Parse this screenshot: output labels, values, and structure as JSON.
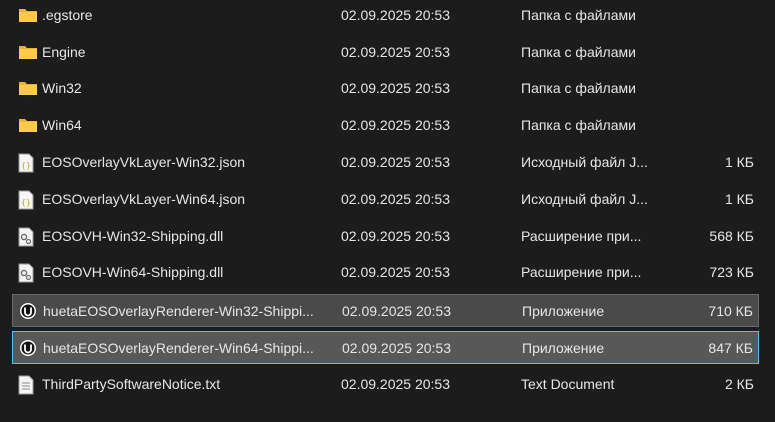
{
  "files": [
    {
      "name": ".egstore",
      "date": "02.09.2025 20:53",
      "type": "Папка с файлами",
      "size": "",
      "icon": "folder-icon"
    },
    {
      "name": "Engine",
      "date": "02.09.2025 20:53",
      "type": "Папка с файлами",
      "size": "",
      "icon": "folder-icon"
    },
    {
      "name": "Win32",
      "date": "02.09.2025 20:53",
      "type": "Папка с файлами",
      "size": "",
      "icon": "folder-icon"
    },
    {
      "name": "Win64",
      "date": "02.09.2025 20:53",
      "type": "Папка с файлами",
      "size": "",
      "icon": "folder-icon"
    },
    {
      "name": "EOSOverlayVkLayer-Win32.json",
      "date": "02.09.2025 20:53",
      "type": "Исходный файл J...",
      "size": "1 КБ",
      "icon": "json-file-icon"
    },
    {
      "name": "EOSOverlayVkLayer-Win64.json",
      "date": "02.09.2025 20:53",
      "type": "Исходный файл J...",
      "size": "1 КБ",
      "icon": "json-file-icon"
    },
    {
      "name": "EOSOVH-Win32-Shipping.dll",
      "date": "02.09.2025 20:53",
      "type": "Расширение при...",
      "size": "568 КБ",
      "icon": "dll-file-icon"
    },
    {
      "name": "EOSOVH-Win64-Shipping.dll",
      "date": "02.09.2025 20:53",
      "type": "Расширение при...",
      "size": "723 КБ",
      "icon": "dll-file-icon"
    },
    {
      "name": "huetaEOSOverlayRenderer-Win32-Shippi...",
      "date": "02.09.2025 20:53",
      "type": "Приложение",
      "size": "710 КБ",
      "icon": "unreal-app-icon"
    },
    {
      "name": "huetaEOSOverlayRenderer-Win64-Shippi...",
      "date": "02.09.2025 20:53",
      "type": "Приложение",
      "size": "847 КБ",
      "icon": "unreal-app-icon"
    },
    {
      "name": "ThirdPartySoftwareNotice.txt",
      "date": "02.09.2025 20:53",
      "type": "Text Document",
      "size": "2 КБ",
      "icon": "text-file-icon"
    }
  ]
}
